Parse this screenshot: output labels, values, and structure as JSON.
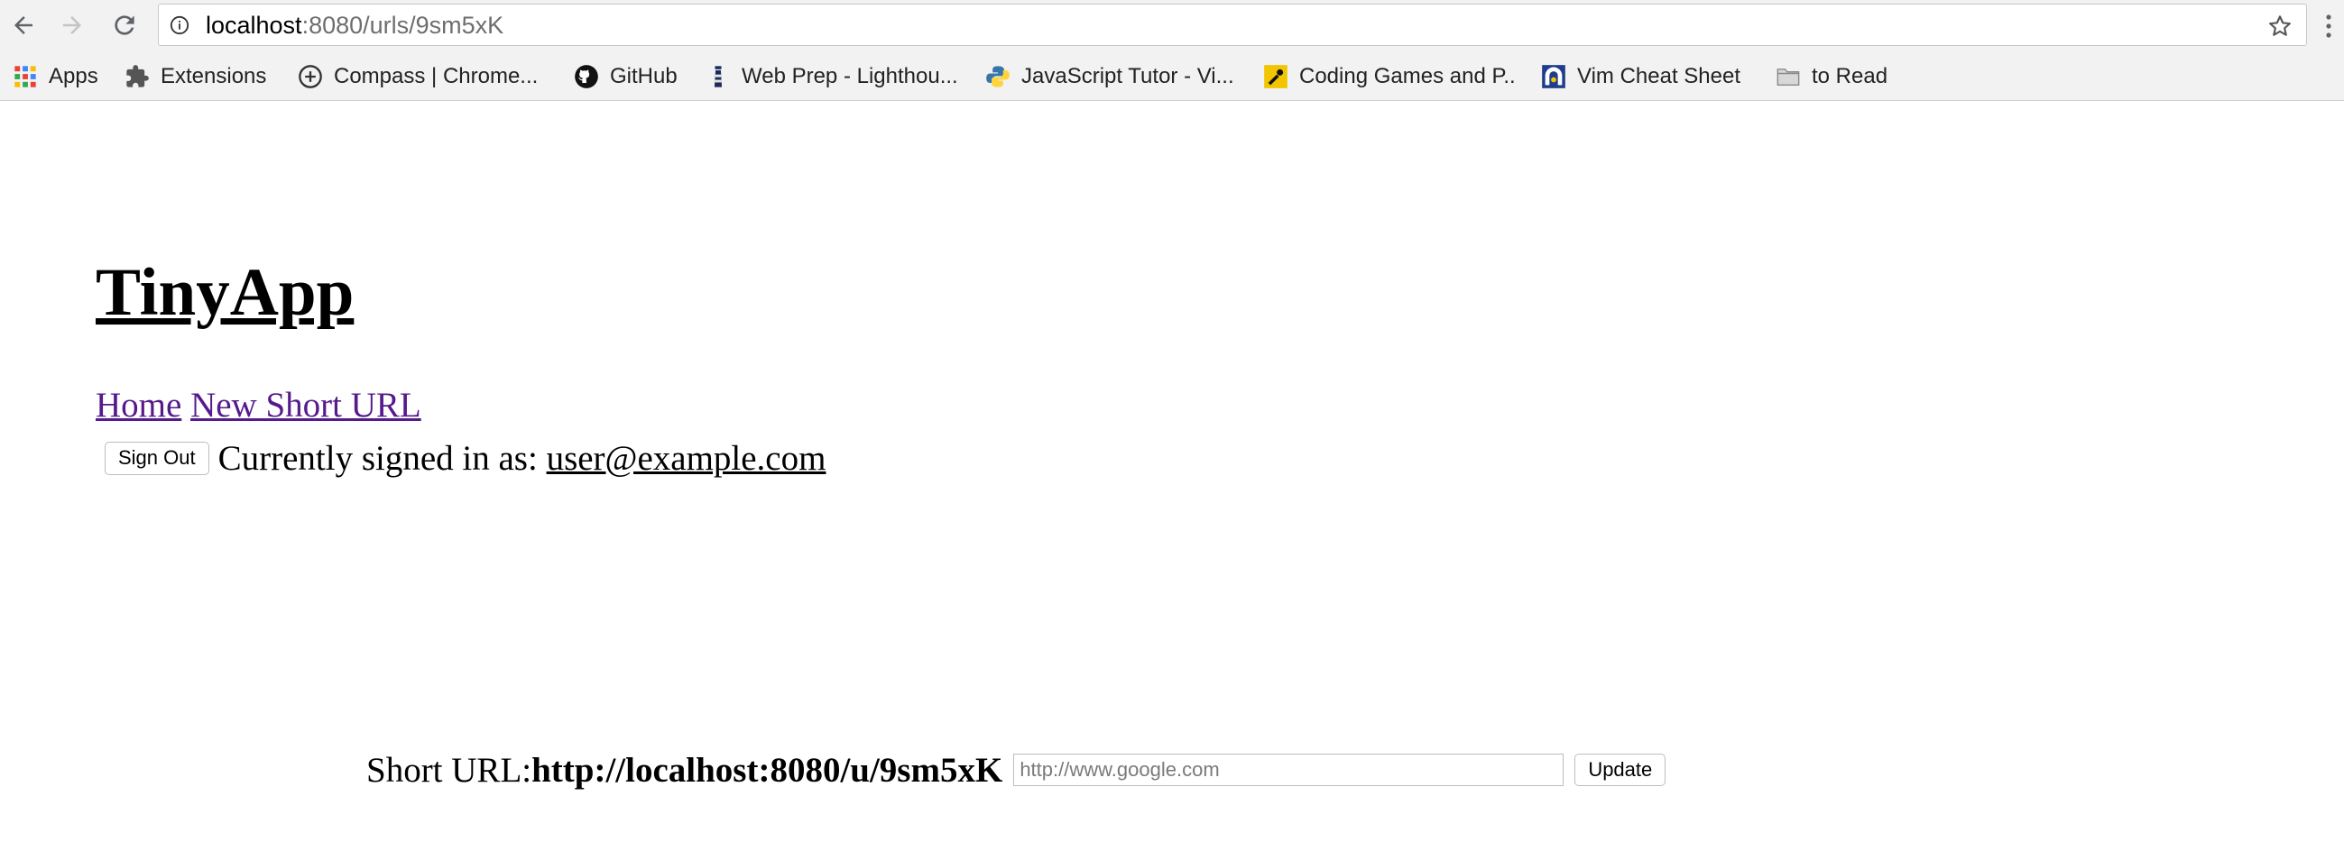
{
  "browser": {
    "url_host": "localhost",
    "url_path": ":8080/urls/9sm5xK",
    "icons": {
      "back": "arrow-left-icon",
      "forward": "arrow-right-icon",
      "reload": "reload-icon",
      "info": "info-icon",
      "bookmark_star": "star-icon",
      "menu": "kebab-menu-icon"
    },
    "bookmarks": [
      {
        "label": "Apps",
        "icon": "apps-grid-icon"
      },
      {
        "label": "Extensions",
        "icon": "puzzle-icon"
      },
      {
        "label": "Compass | Chrome...",
        "icon": "compass-icon"
      },
      {
        "label": "GitHub",
        "icon": "github-icon"
      },
      {
        "label": "Web Prep - Lighthou...",
        "icon": "lighthouse-icon"
      },
      {
        "label": "JavaScript Tutor - Vi...",
        "icon": "python-icon"
      },
      {
        "label": "Coding Games and P..",
        "icon": "codingame-icon"
      },
      {
        "label": "Vim Cheat Sheet",
        "icon": "vim-icon"
      },
      {
        "label": "to Read",
        "icon": "folder-icon"
      }
    ]
  },
  "page": {
    "title": "TinyApp",
    "nav": {
      "home": "Home",
      "new_short_url": "New Short URL"
    },
    "sign_out_label": "Sign Out",
    "signed_in_text": "Currently signed in as:",
    "user_email": "user@example.com",
    "short_url_label": "Short URL:",
    "short_url_value": "http://localhost:8080/u/9sm5xK",
    "long_url_placeholder": "http://www.google.com",
    "update_label": "Update"
  },
  "colors": {
    "visited_link": "#551a8b",
    "chrome_bg": "#f2f2f2"
  }
}
